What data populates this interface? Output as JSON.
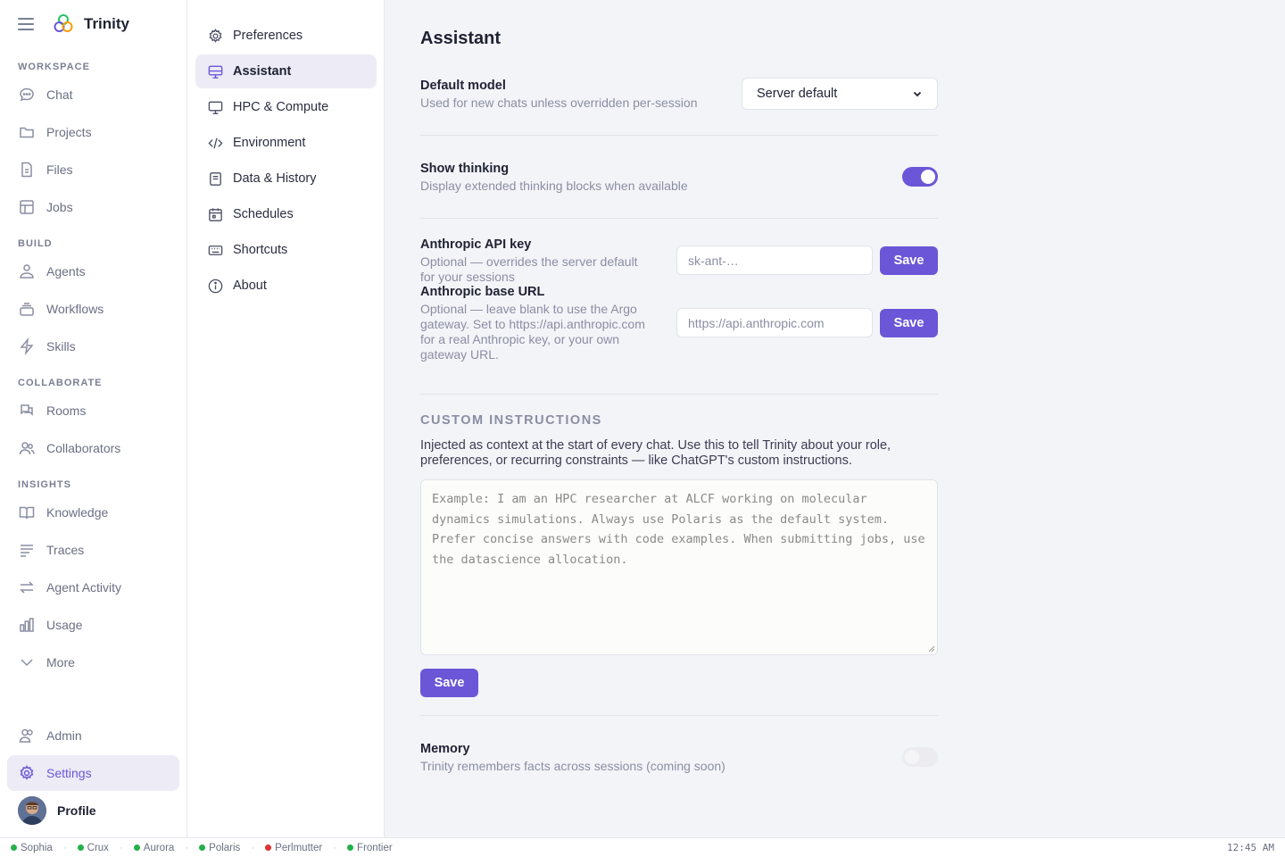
{
  "app": {
    "name": "Trinity"
  },
  "sidebar": {
    "sections": {
      "workspace": "WORKSPACE",
      "build": "BUILD",
      "collaborate": "COLLABORATE",
      "insights": "INSIGHTS"
    },
    "items": {
      "chat": "Chat",
      "projects": "Projects",
      "files": "Files",
      "jobs": "Jobs",
      "agents": "Agents",
      "workflows": "Workflows",
      "skills": "Skills",
      "rooms": "Rooms",
      "collaborators": "Collaborators",
      "knowledge": "Knowledge",
      "traces": "Traces",
      "agent_activity": "Agent Activity",
      "usage": "Usage",
      "more": "More",
      "admin": "Admin",
      "settings": "Settings"
    },
    "profile": "Profile"
  },
  "settings_menu": {
    "preferences": "Preferences",
    "assistant": "Assistant",
    "hpc": "HPC & Compute",
    "environment": "Environment",
    "data_history": "Data & History",
    "schedules": "Schedules",
    "shortcuts": "Shortcuts",
    "about": "About"
  },
  "main": {
    "title": "Assistant",
    "default_model": {
      "title": "Default model",
      "desc": "Used for new chats unless overridden per-session",
      "selected": "Server default"
    },
    "show_thinking": {
      "title": "Show thinking",
      "desc": "Display extended thinking blocks when available",
      "enabled": true
    },
    "api_key": {
      "title": "Anthropic API key",
      "desc1": "Optional — overrides the server default",
      "desc2": "for your sessions",
      "placeholder": "sk-ant-…",
      "save": "Save"
    },
    "base_url": {
      "title": "Anthropic base URL",
      "desc1": "Optional — leave blank to use the Argo",
      "desc2": "gateway. Set to https://api.anthropic.com",
      "desc3": "for a real Anthropic key, or your own",
      "desc4": "gateway URL.",
      "placeholder": "https://api.anthropic.com",
      "save": "Save"
    },
    "custom_instructions": {
      "heading": "CUSTOM INSTRUCTIONS",
      "desc1": "Injected as context at the start of every chat. Use this to tell Trinity about your role,",
      "desc2": "preferences, or recurring constraints — like ChatGPT's custom instructions.",
      "placeholder": "Example: I am an HPC researcher at ALCF working on molecular dynamics simulations. Always use Polaris as the default system. Prefer concise answers with code examples. When submitting jobs, use the datascience allocation.",
      "save": "Save"
    },
    "memory": {
      "title": "Memory",
      "desc": "Trinity remembers facts across sessions (coming soon)",
      "enabled": false
    }
  },
  "statusbar": {
    "systems": [
      {
        "name": "Sophia",
        "color": "#22b04b"
      },
      {
        "name": "Crux",
        "color": "#22b04b"
      },
      {
        "name": "Aurora",
        "color": "#22b04b"
      },
      {
        "name": "Polaris",
        "color": "#22b04b"
      },
      {
        "name": "Perlmutter",
        "color": "#e0312f"
      },
      {
        "name": "Frontier",
        "color": "#22b04b"
      }
    ],
    "time": "12:45 AM"
  },
  "colors": {
    "accent": "#6b56d8",
    "active_bg": "#ecebf6"
  }
}
